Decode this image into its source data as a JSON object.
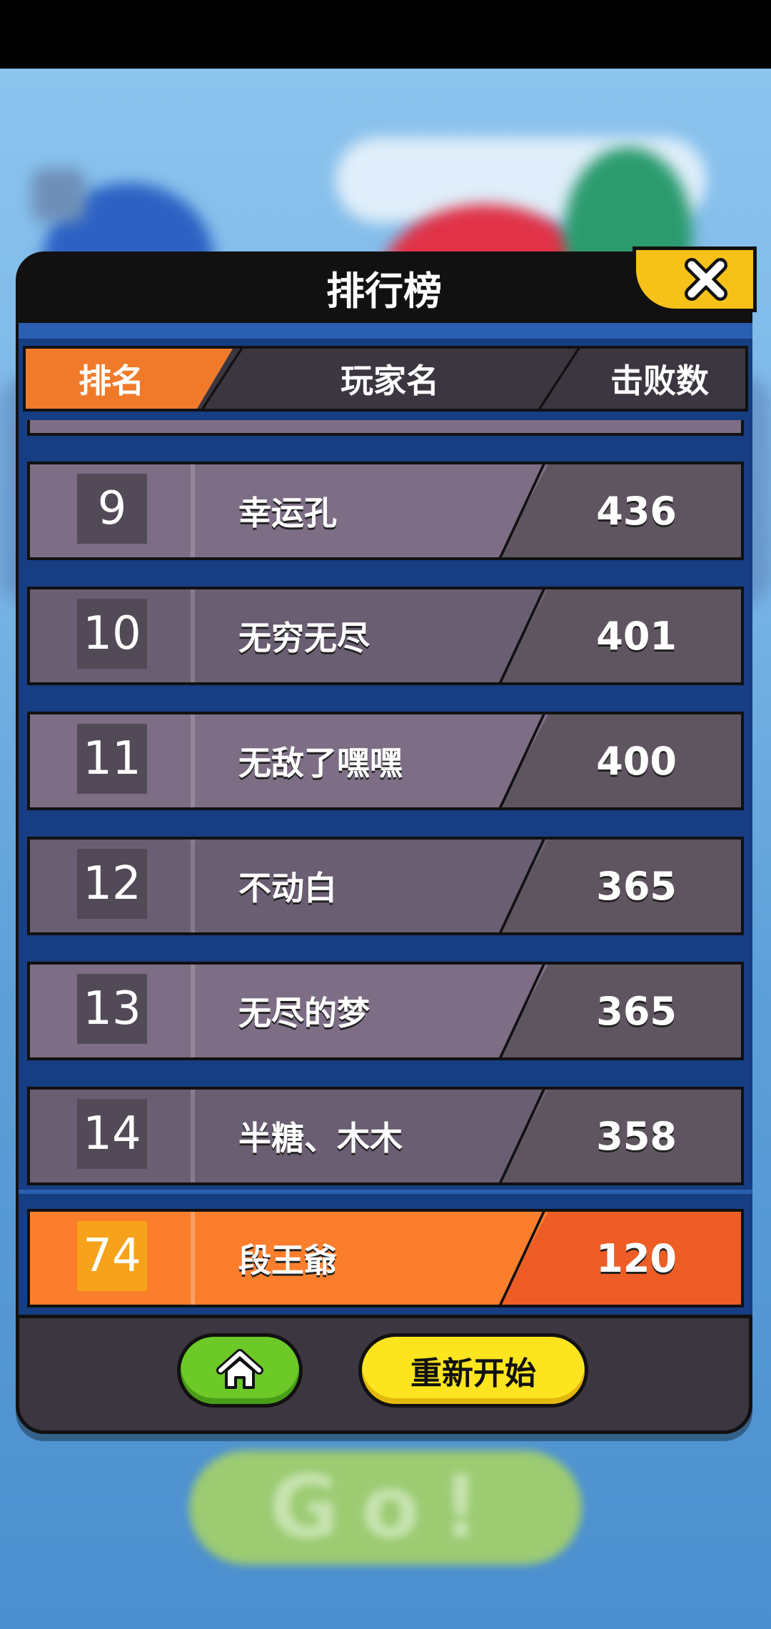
{
  "panel": {
    "title": "排行榜"
  },
  "header": {
    "rank": "排名",
    "player": "玩家名",
    "kills": "击败数"
  },
  "rows": [
    {
      "rank": "9",
      "name": "幸运孔",
      "score": "436"
    },
    {
      "rank": "10",
      "name": "无穷无尽",
      "score": "401"
    },
    {
      "rank": "11",
      "name": "无敌了嘿嘿",
      "score": "400"
    },
    {
      "rank": "12",
      "name": "不动白",
      "score": "365"
    },
    {
      "rank": "13",
      "name": "无尽的梦",
      "score": "365"
    },
    {
      "rank": "14",
      "name": "半糖、木木",
      "score": "358"
    }
  ],
  "my_row": {
    "rank": "74",
    "name": "段王爺",
    "score": "120"
  },
  "footer": {
    "restart_label": "重新开始"
  },
  "background": {
    "go_label": "Go!"
  },
  "icons": {
    "close": "close-icon",
    "home": "home-icon"
  },
  "colors": {
    "accent_orange": "#f07a2a",
    "home_green": "#6cc928",
    "restart_yellow": "#fce51f",
    "close_yellow": "#f6c21a"
  }
}
